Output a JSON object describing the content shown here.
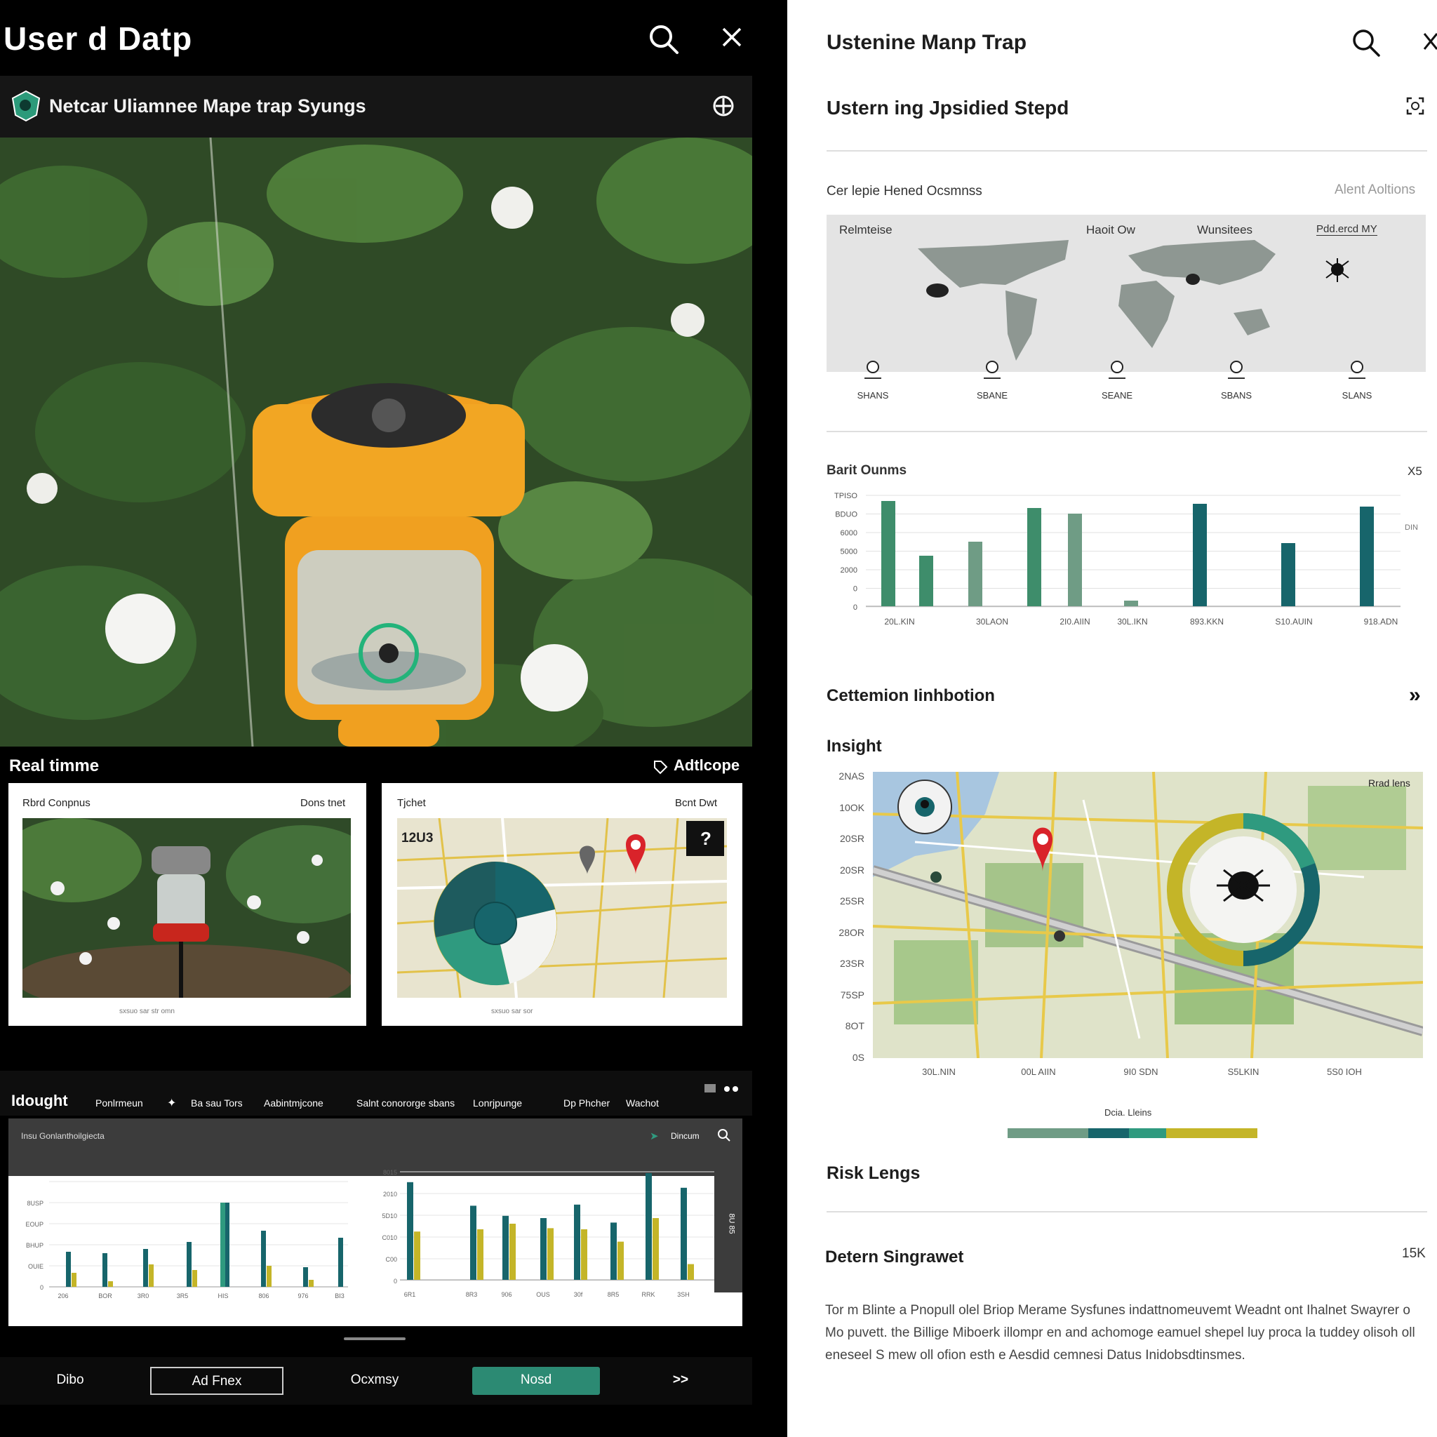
{
  "left": {
    "header": {
      "title": "User d Datp"
    },
    "subbar": {
      "title": "Netcar Uliamnee Mape trap Syungs"
    },
    "realtime": {
      "label": "Real timme",
      "action": "Adtlcope"
    },
    "card1": {
      "title": "Rbrd Conpnus",
      "right": "Dons tnet",
      "caption": "sxsuo   sar   str   omn"
    },
    "card2": {
      "title": "Tjchet",
      "right": "Bcnt Dwt",
      "map_label": "12U3",
      "caption": "sxsuo   sar   sor"
    },
    "insight_nav": {
      "title": "Idought",
      "links": [
        "Ponlrmeun",
        "Ba sau Tors",
        "Aabintmjcone",
        "Salnt conororge sbans",
        "Lonrjpunge",
        "Dp Phcher",
        "Wachot"
      ]
    },
    "insight_panel": {
      "header": "Insu Gonlanthoilgiecta",
      "chip": "Dincum",
      "left_chart": {
        "y_ticks": [
          "",
          "8USP",
          "EOUP",
          "BHUP",
          "OUIE",
          "0"
        ],
        "x_ticks": [
          "206",
          "BOR",
          "3R0",
          "3R5",
          "HIS",
          "806",
          "976",
          "BI3"
        ]
      },
      "right_chart": {
        "y_ticks": [
          "8015",
          "2010",
          "5D10",
          "C010",
          "C00",
          "0"
        ],
        "x_ticks": [
          "6R1",
          "8R3",
          "906",
          "OUS",
          "30f",
          "8R5",
          "RRK",
          "3SH"
        ]
      },
      "side_label": "8U 85"
    },
    "bottom_nav": [
      "Dibo",
      "Ad Fnex",
      "Ocxmsy",
      "Nosd",
      ">>"
    ]
  },
  "right": {
    "header": {
      "title": "Ustenine Manp Trap"
    },
    "subheader": {
      "title": "Ustern ing Jpsidied Stepd"
    },
    "map_section": {
      "title": "Cer lepie Hened Ocsmnss",
      "right": "Alent Aoltions",
      "labels": [
        "Relmteise",
        "Haoit Ow",
        "Wunsitees",
        "Pdd.ercd MY"
      ],
      "pins": [
        "SHANS",
        "SBANE",
        "SEANE",
        "SBANS",
        "SLANS"
      ]
    },
    "bar_section": {
      "title": "Barit Ounms",
      "right": "X5",
      "side": "DIN",
      "y_ticks": [
        "TPISO",
        "BDUO",
        "6000",
        "5000",
        "2000",
        "0",
        "0"
      ],
      "x_ticks": [
        "20L.KIN",
        "30LAON",
        "2I0.AIIN",
        "30L.IKN",
        "893.KKN",
        "S10.AUIN",
        "918.ADN"
      ]
    },
    "detection": {
      "title": "Cettemion Iinhbotion"
    },
    "insight": {
      "title": "Insight",
      "y_ticks": [
        "2NAS",
        "10OK",
        "20SR",
        "20SR",
        "25SR",
        "28OR",
        "23SR",
        "75SP",
        "8OT",
        "0S"
      ],
      "x_ticks": [
        "30L.NIN",
        "00L AIIN",
        "9I0 SDN",
        "S5LKIN",
        "5S0 IOH"
      ],
      "map_corner": "Rrad lens",
      "legend": "Dcia. Lleins"
    },
    "risk": {
      "title": "Risk Lengs"
    },
    "detern": {
      "title": "Detern Singrawet",
      "right": "15K",
      "paragraph": "Tor m Blinte a Pnopull olel Briop Merame Sysfunes indattnomeuvemt Weadnt ont Ihalnet Swayrer o Mo puvett. the Billige Miboerk illompr en and achomoge eamuel shepel luy proca la tuddey olisoh oll eneseel S mew oll ofion esth e Aesdid cemnesi Datus Inidobsdtinsmes."
    },
    "colors": {
      "teal": "#17656b",
      "green": "#3e8d6b",
      "sage": "#6f9c85",
      "mustard": "#c4b528",
      "mint": "#2f9a7f"
    }
  }
}
